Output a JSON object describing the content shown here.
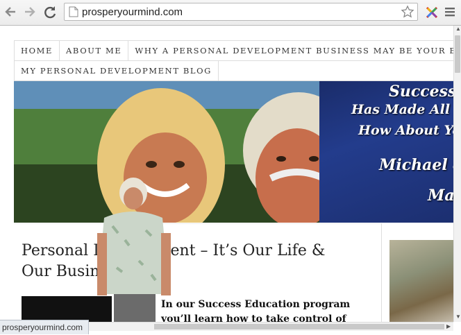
{
  "browser": {
    "url": "prosperyourmind.com",
    "status_url": "prosperyourmind.com"
  },
  "nav": {
    "items": [
      {
        "label": "HOME"
      },
      {
        "label": "ABOUT ME"
      },
      {
        "label": "WHY A PERSONAL DEVELOPMENT BUSINESS MAY BE YOUR BEST"
      },
      {
        "label": "MY PERSONAL DEVELOPMENT BLOG"
      }
    ]
  },
  "hero": {
    "line1": "Success",
    "line2": "Has Made All t",
    "line3": "How About Yo",
    "line4": "Michael &",
    "line5": "Ma"
  },
  "post": {
    "title": "Personal Development – It’s Our Life & Our Business",
    "excerpt": "In our Success Education program you’ll learn how to take control of your life in"
  },
  "colors": {
    "hero_right": "#233c8c",
    "chrome": "#f0f0f0"
  }
}
